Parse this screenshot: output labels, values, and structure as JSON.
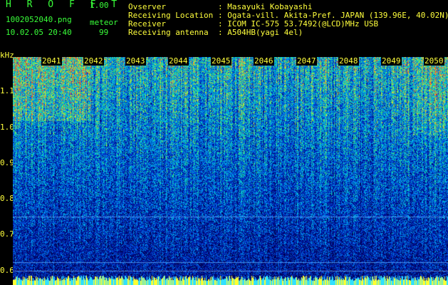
{
  "header": {
    "app_title": "H R O F F T",
    "app_version": "1.00",
    "file_name": "1002052040.png",
    "mode": "meteor",
    "datetime": "10.02.05 20:40",
    "count": "99"
  },
  "info": [
    {
      "key": "Ovserver",
      "value": ": Masayuki Kobayashi"
    },
    {
      "key": "Receiving Location",
      "value": ": Ogata-vill. Akita-Pref. JAPAN (139.96E, 40.02N)"
    },
    {
      "key": "Receiver",
      "value": ": ICOM IC-575 53.7492(@LCD)MHz USB"
    },
    {
      "key": "Receiving antenna",
      "value": ": A504HB(yagi 4el)"
    }
  ],
  "spectrogram": {
    "x_ticks": [
      "2041",
      "2042",
      "2043",
      "2044",
      "2045",
      "2046",
      "2047",
      "2048",
      "2049",
      "2050"
    ],
    "y_unit": "kHz",
    "y_ticks": [
      "1.1",
      "1.0",
      "0.9",
      "0.8",
      "0.7",
      "0.6"
    ],
    "colors": {
      "low": "#00008c",
      "mid": "#0090ff",
      "high": "#ffff00",
      "peak": "#ff2020",
      "axis": "#ffff3c",
      "text": "#39ff39"
    }
  }
}
